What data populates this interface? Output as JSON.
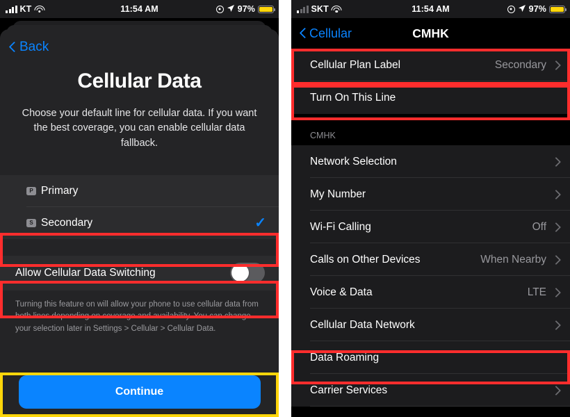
{
  "left": {
    "statusbar": {
      "carrier": "KT",
      "signal_icon": "signal-bars-full-icon",
      "wifi_icon": "wifi-icon",
      "time": "11:54 AM",
      "dnd_icon": "do-not-disturb-icon",
      "location_icon": "location-arrow-icon",
      "battery_percent": "97%",
      "battery_icon": "battery-low-power-icon"
    },
    "nav": {
      "back_label": "Back",
      "back_icon": "chevron-left-icon"
    },
    "hero": {
      "title": "Cellular Data",
      "description": "Choose your default line for cellular data. If you want the best coverage, you can enable cellular data fallback."
    },
    "lines": [
      {
        "badge": "P",
        "label": "Primary",
        "selected": false
      },
      {
        "badge": "S",
        "label": "Secondary",
        "selected": true,
        "check_icon": "checkmark-icon"
      }
    ],
    "switching": {
      "label": "Allow Cellular Data Switching",
      "toggle_state": "off",
      "footnote": "Turning this feature on will allow your phone to use cellular data from both lines depending on coverage and availability. You can change your selection later in Settings > Cellular > Cellular Data."
    },
    "cta": {
      "label": "Continue"
    }
  },
  "right": {
    "statusbar": {
      "carrier": "SKT",
      "signal_icon": "signal-bars-weak-icon",
      "wifi_icon": "wifi-icon",
      "time": "11:54 AM",
      "dnd_icon": "do-not-disturb-icon",
      "location_icon": "location-arrow-icon",
      "battery_percent": "97%",
      "battery_icon": "battery-low-power-icon"
    },
    "nav": {
      "back_label": "Cellular",
      "back_icon": "chevron-left-icon",
      "title": "CMHK"
    },
    "top_group": [
      {
        "label": "Cellular Plan Label",
        "value": "Secondary",
        "accessory": "chevron-right-icon"
      },
      {
        "label": "Turn On This Line",
        "toggle_state": "on",
        "accessory": "toggle-switch"
      }
    ],
    "section_header": "CMHK",
    "settings": [
      {
        "label": "Network Selection",
        "value": "",
        "accessory": "chevron-right-icon"
      },
      {
        "label": "My Number",
        "value": "",
        "accessory": "chevron-right-icon"
      },
      {
        "label": "Wi-Fi Calling",
        "value": "Off",
        "accessory": "chevron-right-icon"
      },
      {
        "label": "Calls on Other Devices",
        "value": "When Nearby",
        "accessory": "chevron-right-icon"
      },
      {
        "label": "Voice & Data",
        "value": "LTE",
        "accessory": "chevron-right-icon"
      },
      {
        "label": "Cellular Data Network",
        "value": "",
        "accessory": "chevron-right-icon"
      },
      {
        "label": "Data Roaming",
        "toggle_state": "on",
        "accessory": "toggle-switch"
      },
      {
        "label": "Carrier Services",
        "value": "",
        "accessory": "chevron-right-icon"
      }
    ]
  },
  "annotations": {
    "highlight_red": "#ff2d2d",
    "highlight_yellow": "#ffd60a",
    "accent_blue": "#0a84ff",
    "toggle_on_green": "#30d158"
  }
}
